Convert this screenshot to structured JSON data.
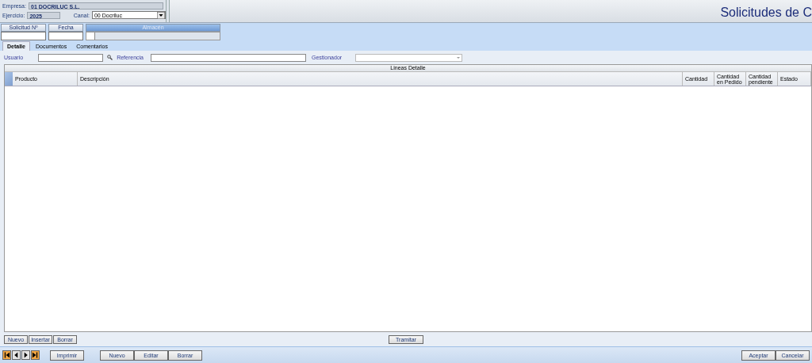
{
  "header": {
    "empresa_label": "Empresa:",
    "empresa_value": "01 DOCRILUC S.L.",
    "ejercicio_label": "Ejercicio:",
    "ejercicio_value": "2025",
    "canal_label": "Canal:",
    "canal_value": "00 Docriluc",
    "title": "Solicitudes de C"
  },
  "key_fields": [
    {
      "label": "Solicitud Nº",
      "disabled": false
    },
    {
      "label": "Fecha",
      "disabled": false
    },
    {
      "label": "Almacén",
      "disabled": true
    }
  ],
  "tabs": [
    {
      "label": "Detalle",
      "selected": true
    },
    {
      "label": "Documentos",
      "selected": false
    },
    {
      "label": "Comentarios",
      "selected": false
    }
  ],
  "filters": {
    "usuario_label": "Usuario",
    "referencia_label": "Referencia",
    "gestionador_label": "Gestionador"
  },
  "grid": {
    "title": "Lineas Detalle",
    "columns": [
      "Producto",
      "Descripción",
      "Cantidad",
      "Cantidad en Pedido",
      "Cantidad pendiente",
      "Estado"
    ]
  },
  "grid_buttons": [
    "Nuevo",
    "Insertar",
    "Borrar"
  ],
  "tramitar_button": "Tramitar",
  "nav_buttons": [
    {
      "kind": "first",
      "highlighted": true
    },
    {
      "kind": "prev",
      "highlighted": false
    },
    {
      "kind": "next",
      "highlighted": false
    },
    {
      "kind": "last",
      "highlighted": true
    }
  ],
  "print_button": "Imprimir",
  "record_buttons": [
    "Nuevo",
    "Editar",
    "Borrar"
  ],
  "dialog_buttons": [
    "Aceptar",
    "Cancelar"
  ]
}
